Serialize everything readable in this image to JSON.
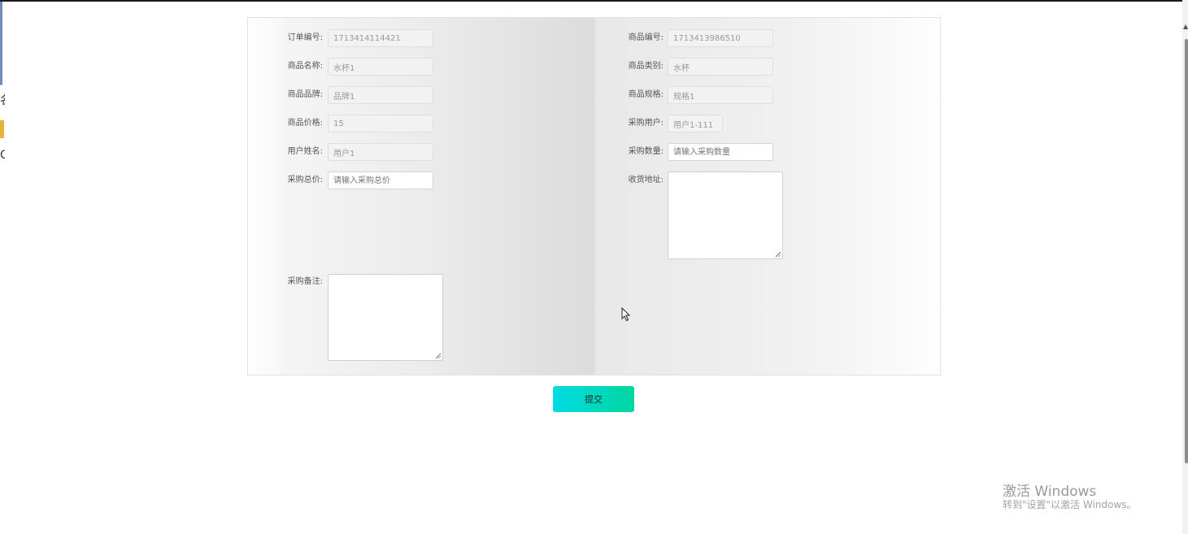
{
  "left_column": [
    {
      "key": "order_no",
      "label": "订单编号:",
      "value": "1713414114421",
      "placeholder": "",
      "editable": false
    },
    {
      "key": "goods_name",
      "label": "商品名称:",
      "value": "水杯1",
      "placeholder": "",
      "editable": false
    },
    {
      "key": "goods_brand",
      "label": "商品品牌:",
      "value": "品牌1",
      "placeholder": "",
      "editable": false
    },
    {
      "key": "goods_price",
      "label": "商品价格:",
      "value": "15",
      "placeholder": "",
      "editable": false
    },
    {
      "key": "user_name",
      "label": "用户姓名:",
      "value": "用户1",
      "placeholder": "",
      "editable": false
    },
    {
      "key": "total_price",
      "label": "采购总价:",
      "value": "",
      "placeholder": "请输入采购总价",
      "editable": true
    }
  ],
  "right_column": [
    {
      "key": "goods_no",
      "label": "商品编号:",
      "value": "1713413986510",
      "placeholder": "",
      "editable": false
    },
    {
      "key": "goods_category",
      "label": "商品类别:",
      "value": "水杯",
      "placeholder": "",
      "editable": false
    },
    {
      "key": "goods_spec",
      "label": "商品规格:",
      "value": "规格1",
      "placeholder": "",
      "editable": false
    },
    {
      "key": "purchase_user",
      "label": "采购用户:",
      "value": "用户1-111",
      "placeholder": "",
      "editable": false
    },
    {
      "key": "purchase_qty",
      "label": "采购数量:",
      "value": "",
      "placeholder": "请输入采购数量",
      "editable": true
    }
  ],
  "address": {
    "label": "收货地址:",
    "value": ""
  },
  "remark": {
    "label": "采购备注:",
    "value": ""
  },
  "submit_label": "提交",
  "watermark": {
    "title": "激活 Windows",
    "subtitle": "转到\"设置\"以激活 Windows。"
  }
}
